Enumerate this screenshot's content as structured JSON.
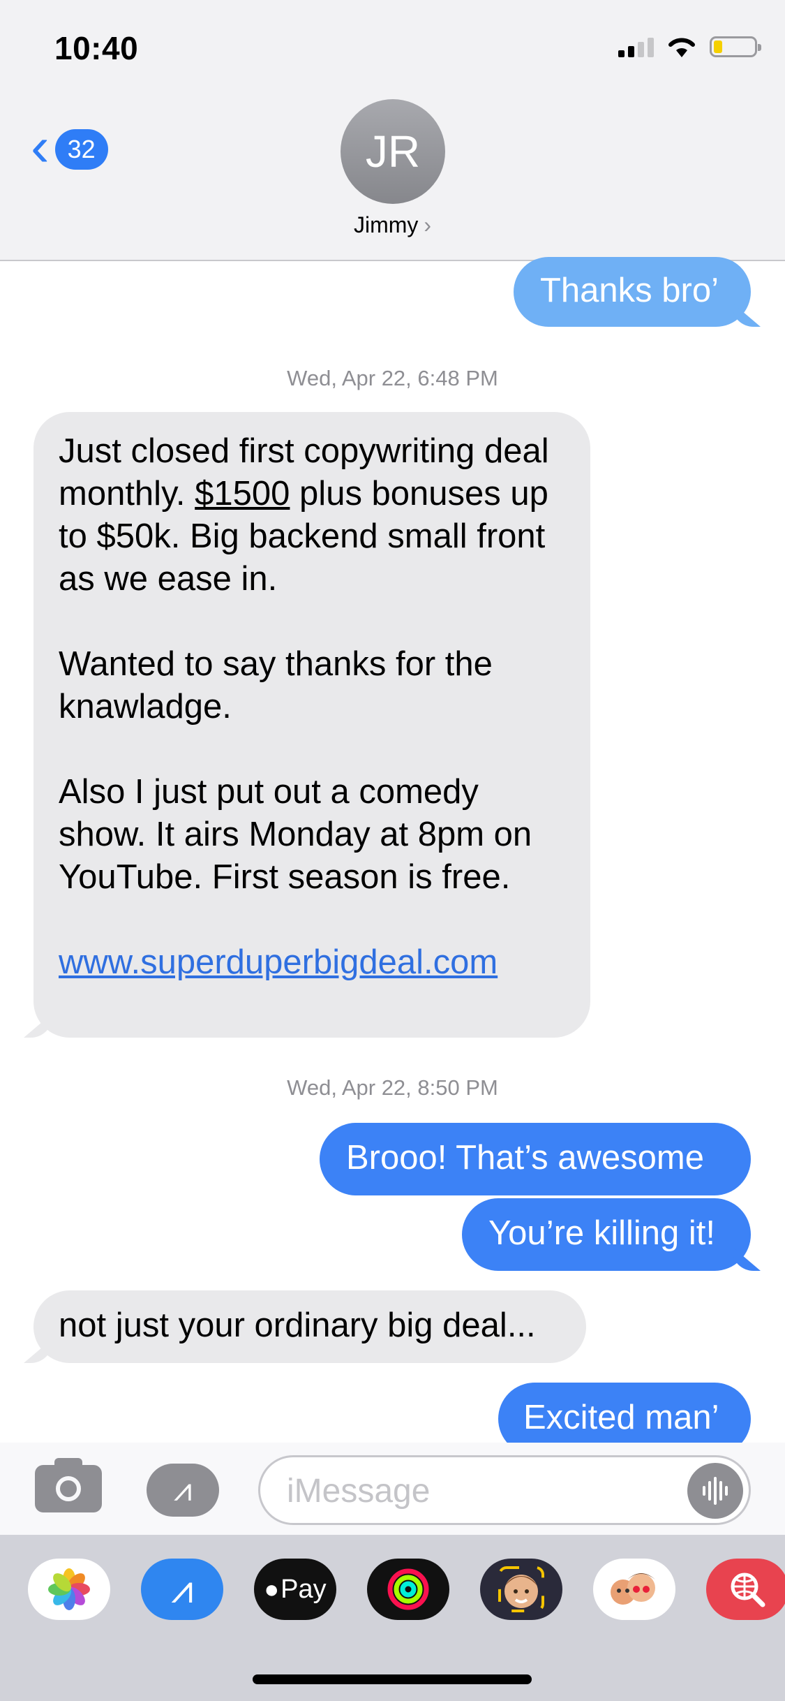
{
  "status_bar": {
    "time": "10:40"
  },
  "nav": {
    "back_count": "32",
    "avatar_initials": "JR",
    "contact_name": "Jimmy",
    "chevron": "›"
  },
  "messages": {
    "m1": "Thanks bro’",
    "ts1": "Wed, Apr 22, 6:48 PM",
    "m2_a": "Just closed first copywriting deal monthly. ",
    "m2_b": "$1500",
    "m2_c": " plus bonuses up to $50k. Big backend small front as we ease in.",
    "m2_d": "Wanted to say thanks for the knawladge.",
    "m2_e": "Also I just put out a comedy show. It airs Monday at 8pm on YouTube. First season is free.",
    "m2_link": "www.superduperbigdeal.com",
    "ts2": "Wed, Apr 22, 8:50 PM",
    "m3": "Brooo! That’s awesome",
    "m4": "You’re killing it!",
    "m5": "not just your ordinary big deal...",
    "m6": "Excited man’"
  },
  "input": {
    "placeholder": "iMessage"
  },
  "drawer": {
    "apple_pay_label": "Pay",
    "apps": [
      "photos-icon",
      "app-store-icon",
      "apple-pay-icon",
      "activity-icon",
      "memoji-icon",
      "animoji-stickers-icon",
      "web-search-icon"
    ]
  },
  "colors": {
    "accent": "#2f7df6",
    "outgoing": "#3c82f6",
    "incoming": "#e9e9eb"
  }
}
